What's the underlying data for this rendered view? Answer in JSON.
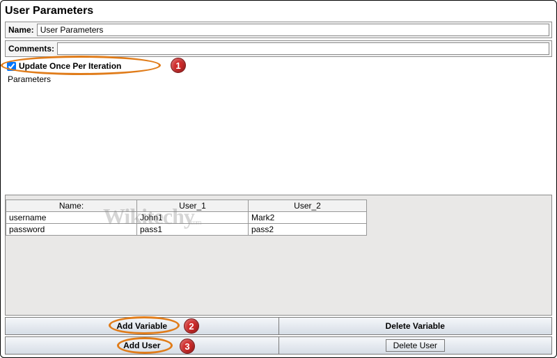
{
  "title": "User Parameters",
  "nameLabel": "Name:",
  "nameValue": "User Parameters",
  "commentsLabel": "Comments:",
  "commentsValue": "",
  "updateOnceLabel": "Update Once Per Iteration",
  "updateOnceChecked": true,
  "paramsGroupLabel": "Parameters",
  "table": {
    "headers": [
      "Name:",
      "User_1",
      "User_2"
    ],
    "rows": [
      [
        "username",
        "John1",
        "Mark2"
      ],
      [
        "password",
        "pass1",
        "pass2"
      ]
    ]
  },
  "watermark": {
    "main": "Wikitechy",
    "sub": ".com"
  },
  "annotations": {
    "one": "1",
    "two": "2",
    "three": "3"
  },
  "buttons": {
    "addVariable": "Add Variable",
    "deleteVariable": "Delete Variable",
    "addUser": "Add User",
    "deleteUser": "Delete User"
  }
}
